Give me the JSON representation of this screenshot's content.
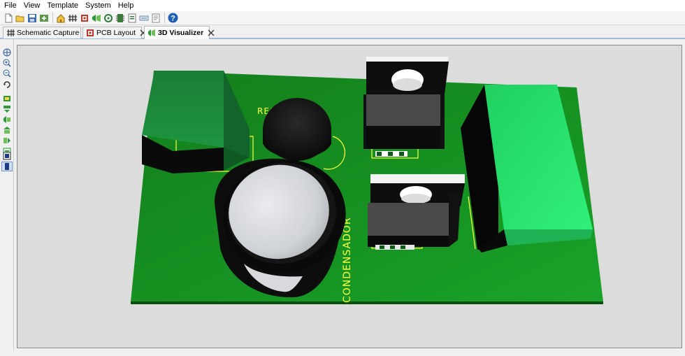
{
  "menu": [
    "File",
    "View",
    "Template",
    "System",
    "Help"
  ],
  "toolbar": {
    "icons": [
      "new-file-icon",
      "open-folder-icon",
      "save-icon",
      "import-icon",
      "home-icon",
      "schematic-icon",
      "pcb-icon",
      "visualizer-icon",
      "gerber-icon",
      "component-icon",
      "bom-icon",
      "design-explorer-icon",
      "notes-icon",
      "help-icon"
    ]
  },
  "tabs": [
    {
      "label": "Schematic Capture",
      "icon": "schematic-icon",
      "active": false
    },
    {
      "label": "PCB Layout",
      "icon": "pcb-icon",
      "active": false
    },
    {
      "label": "3D Visualizer",
      "icon": "visualizer-icon",
      "active": true
    }
  ],
  "left_tools": [
    "pan-icon",
    "zoom-in-icon",
    "zoom-out-icon",
    "rotate-icon",
    "top-view-icon",
    "bottom-view-icon",
    "front-view-icon",
    "back-view-icon",
    "left-view-icon",
    "right-view-icon",
    "board-view-icon",
    "component-view-icon"
  ],
  "board": {
    "label_regulator": "REGULADOR",
    "label_capacitor": "CONDENSADOR",
    "colors": {
      "pcb": "#127a1a",
      "pcb_edge": "#0b4f10",
      "silkscreen": "#ffff40",
      "relay_green": "#1a8a3a",
      "terminal_green": "#22e06a",
      "component_black": "#111111"
    }
  }
}
